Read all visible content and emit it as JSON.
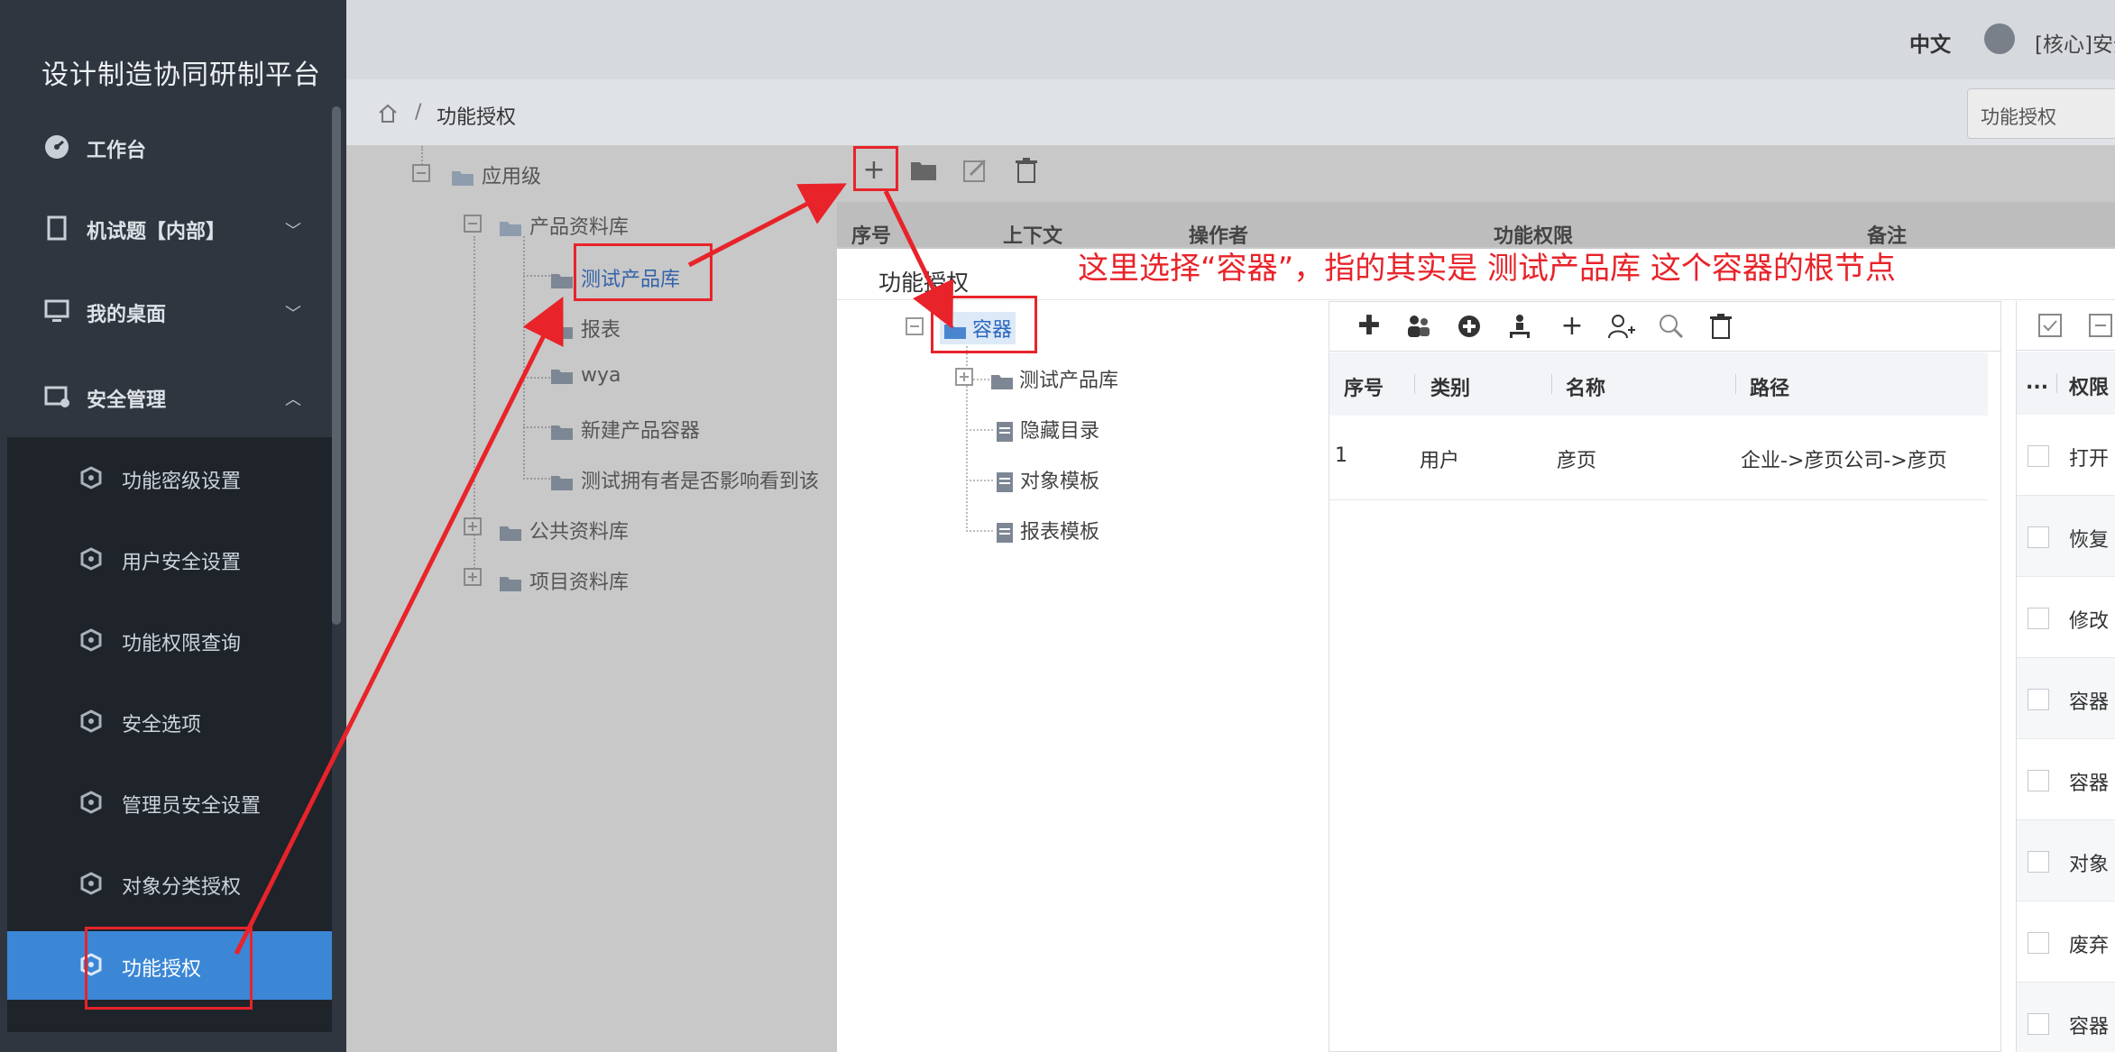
{
  "app": {
    "title": "设计制造协同研制平台"
  },
  "header": {
    "lang": "中文",
    "user": "[核心]安全"
  },
  "breadcrumb": {
    "sep": "/",
    "current": "功能授权"
  },
  "tab_tag": "功能授权",
  "sidebar": {
    "top_items": [
      {
        "label": "工作台",
        "icon": "dashboard-icon"
      },
      {
        "label": "机试题【内部】",
        "icon": "book-icon",
        "chevron": "﹀"
      },
      {
        "label": "我的桌面",
        "icon": "monitor-icon",
        "chevron": "﹀"
      },
      {
        "label": "安全管理",
        "icon": "security-icon",
        "chevron": "︿"
      }
    ],
    "sub_items": [
      {
        "label": "功能密级设置"
      },
      {
        "label": "用户安全设置"
      },
      {
        "label": "功能权限查询"
      },
      {
        "label": "安全选项"
      },
      {
        "label": "管理员安全设置"
      },
      {
        "label": "对象分类授权"
      },
      {
        "label": "功能授权",
        "active": true
      }
    ]
  },
  "bg_tree": {
    "nodes": [
      "应用级",
      "产品资料库",
      "测试产品库",
      "报表",
      "wya",
      "新建产品容器",
      "测试拥有者是否影响看到该",
      "公共资料库",
      "项目资料库"
    ]
  },
  "bg_table_head": [
    "序号",
    "上下文",
    "操作者",
    "功能权限",
    "备注"
  ],
  "dialog": {
    "title": "功能授权",
    "tree": [
      "容器",
      "测试产品库",
      "隐藏目录",
      "对象模板",
      "报表模板"
    ],
    "grid_columns": [
      "序号",
      "类别",
      "名称",
      "路径"
    ],
    "grid_rows": [
      {
        "no": "1",
        "type": "用户",
        "name": "彦页",
        "path": "企业->彦页公司->彦页"
      }
    ],
    "right_header": [
      "...",
      "权限"
    ],
    "right_rows": [
      "打开",
      "恢复",
      "修改",
      "容器",
      "容器",
      "对象",
      "废弃",
      "容器"
    ]
  },
  "annotation": {
    "text": "这里选择“容器”，指的其实是 测试产品库 这个容器的根节点",
    "color": "#e8232a"
  }
}
